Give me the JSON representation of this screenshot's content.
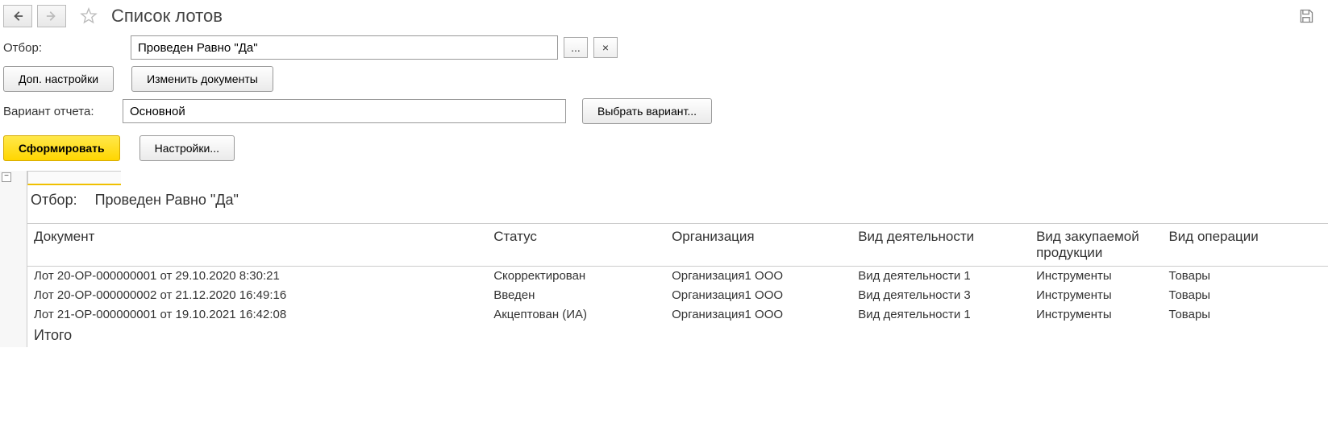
{
  "header": {
    "title": "Список лотов"
  },
  "filter": {
    "label": "Отбор:",
    "value": "Проведен Равно \"Да\"",
    "more_btn": "...",
    "clear_btn": "×"
  },
  "buttons": {
    "additional_settings": "Доп. настройки",
    "edit_documents": "Изменить документы",
    "select_variant": "Выбрать вариант...",
    "generate": "Сформировать",
    "settings": "Настройки..."
  },
  "variant": {
    "label": "Вариант отчета:",
    "value": "Основной"
  },
  "report": {
    "collapse_symbol": "−",
    "filter_label": "Отбор:",
    "filter_value": "Проведен Равно \"Да\"",
    "columns": {
      "document": "Документ",
      "status": "Статус",
      "organization": "Организация",
      "activity": "Вид деятельности",
      "product_type": "Вид закупаемой продукции",
      "operation_type": "Вид операции"
    },
    "rows": [
      {
        "document": "Лот 20-ОР-000000001 от 29.10.2020 8:30:21",
        "status": "Скорректирован",
        "organization": "Организация1 ООО",
        "activity": "Вид деятельности 1",
        "product_type": "Инструменты",
        "operation_type": "Товары"
      },
      {
        "document": "Лот 20-ОР-000000002 от 21.12.2020 16:49:16",
        "status": "Введен",
        "organization": "Организация1 ООО",
        "activity": "Вид деятельности 3",
        "product_type": "Инструменты",
        "operation_type": "Товары"
      },
      {
        "document": "Лот 21-ОР-000000001 от 19.10.2021 16:42:08",
        "status": "Акцептован (ИА)",
        "organization": "Организация1 ООО",
        "activity": "Вид деятельности 1",
        "product_type": "Инструменты",
        "operation_type": "Товары"
      }
    ],
    "total_label": "Итого"
  }
}
